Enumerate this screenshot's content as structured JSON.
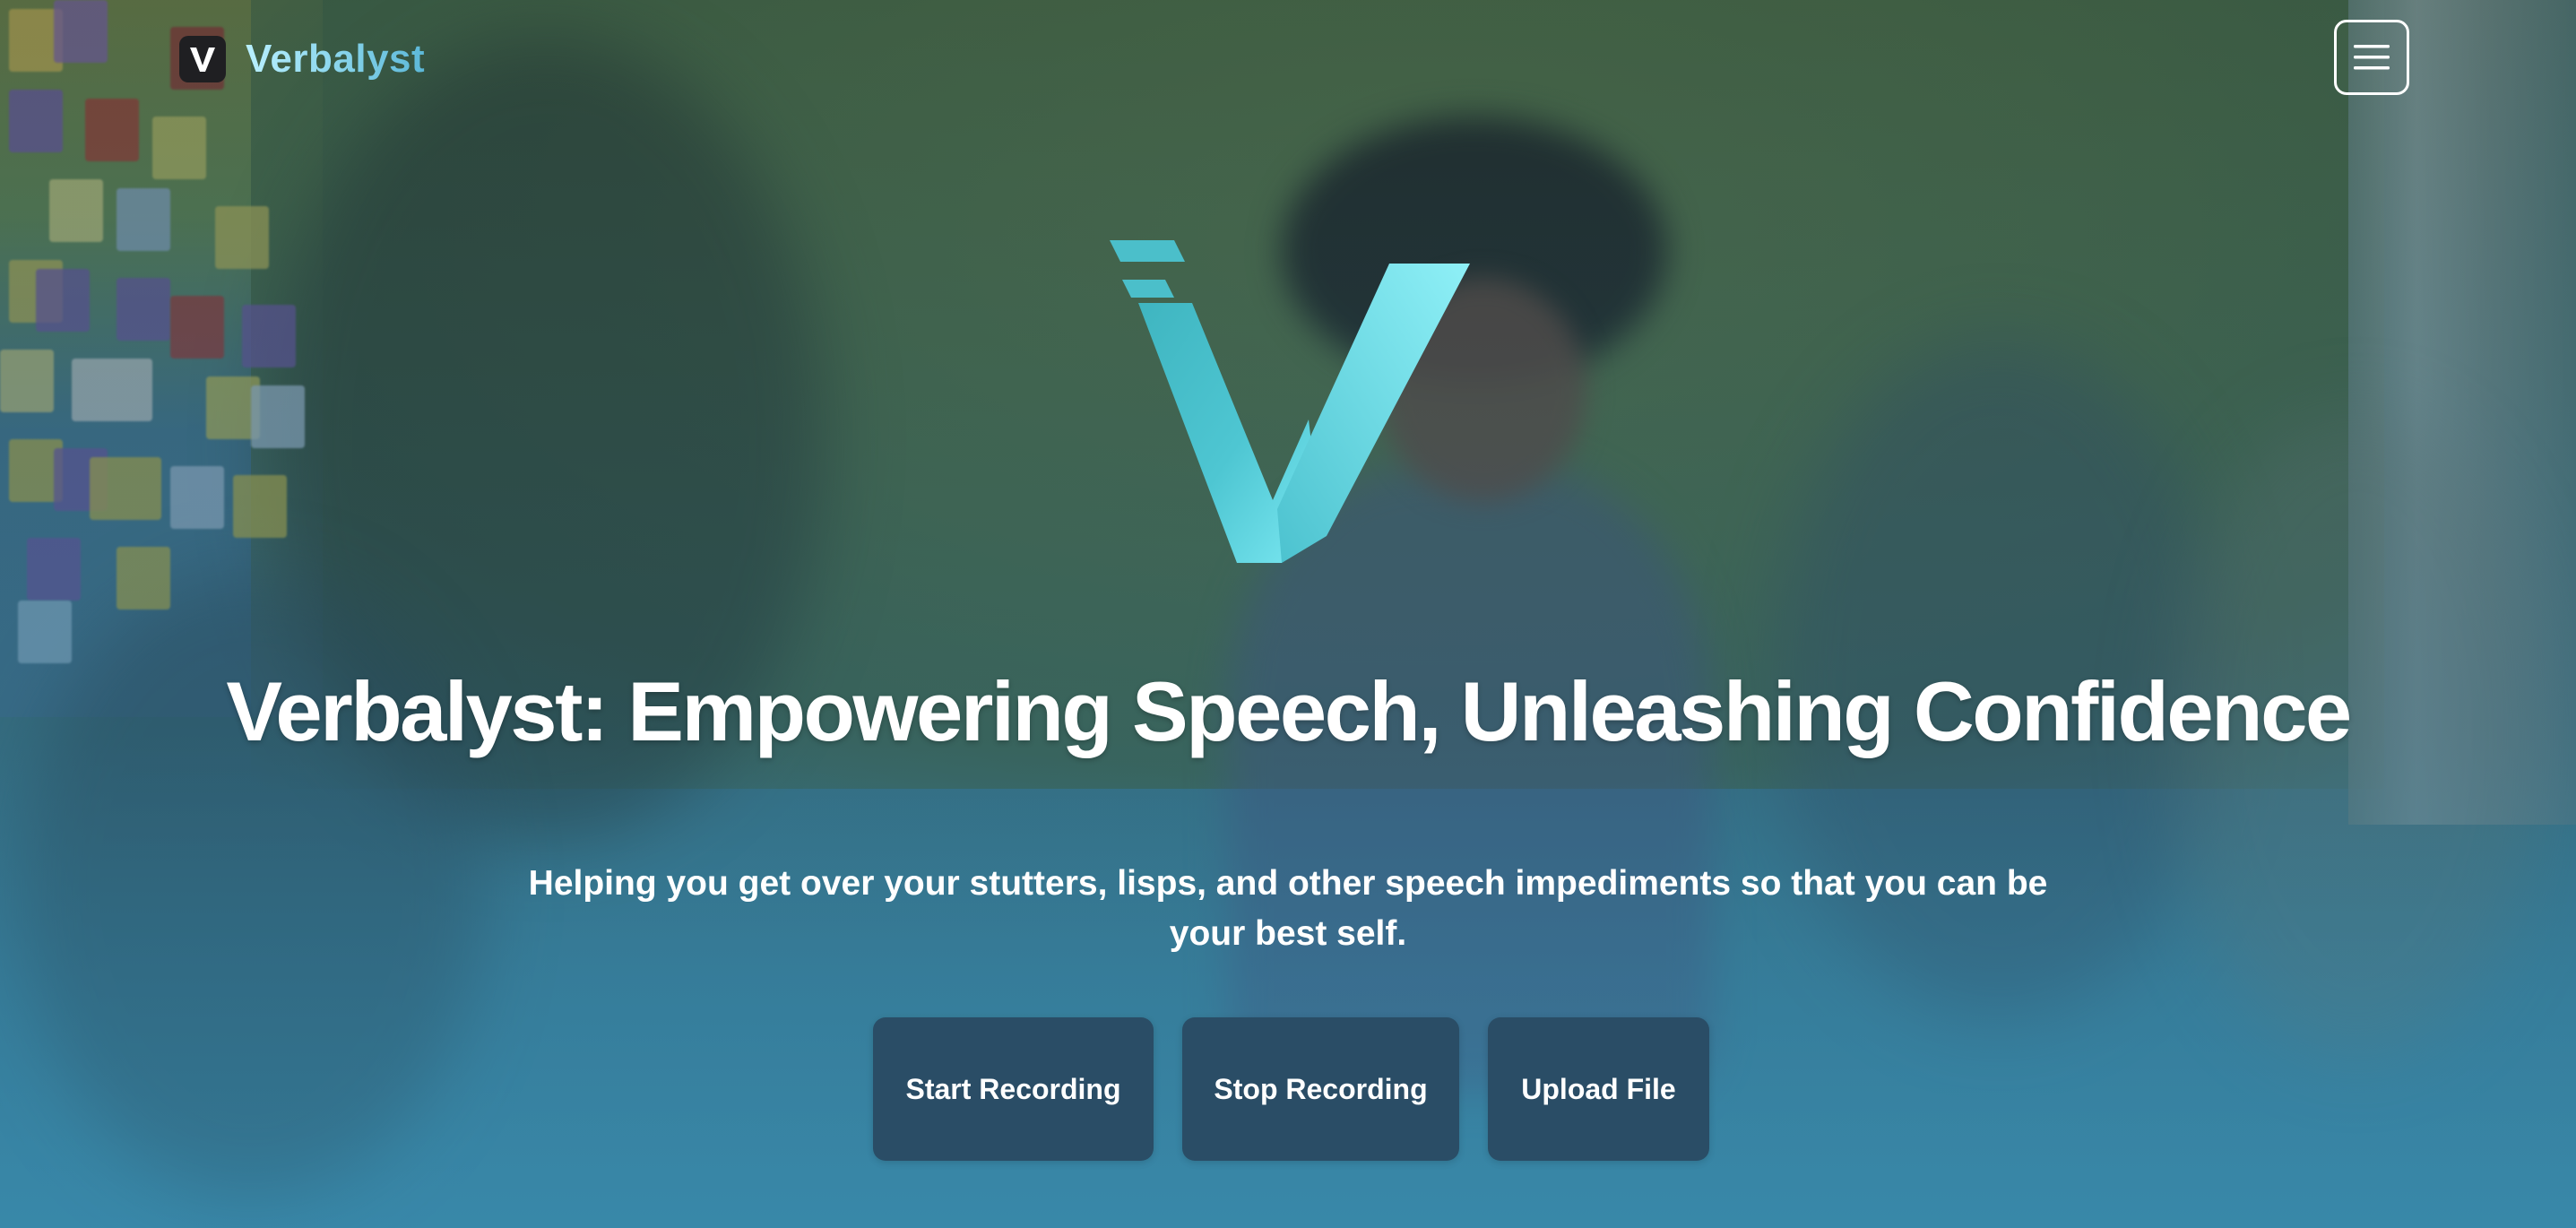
{
  "brand": {
    "name": "Verbalyst",
    "icon": "verbalyst-v-logo"
  },
  "nav": {
    "menu_icon": "hamburger-menu-icon"
  },
  "hero": {
    "logo_icon": "verbalyst-large-v-logo",
    "title": "Verbalyst: Empowering Speech, Unleashing Confidence",
    "subtitle": "Helping you get over your stutters, lisps, and other speech impediments so that you can be your best self.",
    "buttons": {
      "start_recording": "Start Recording",
      "stop_recording": "Stop Recording",
      "upload_file": "Upload File"
    }
  },
  "colors": {
    "accent": "#5bd3e3",
    "button_bg": "#2a4d66",
    "text": "#ffffff"
  }
}
